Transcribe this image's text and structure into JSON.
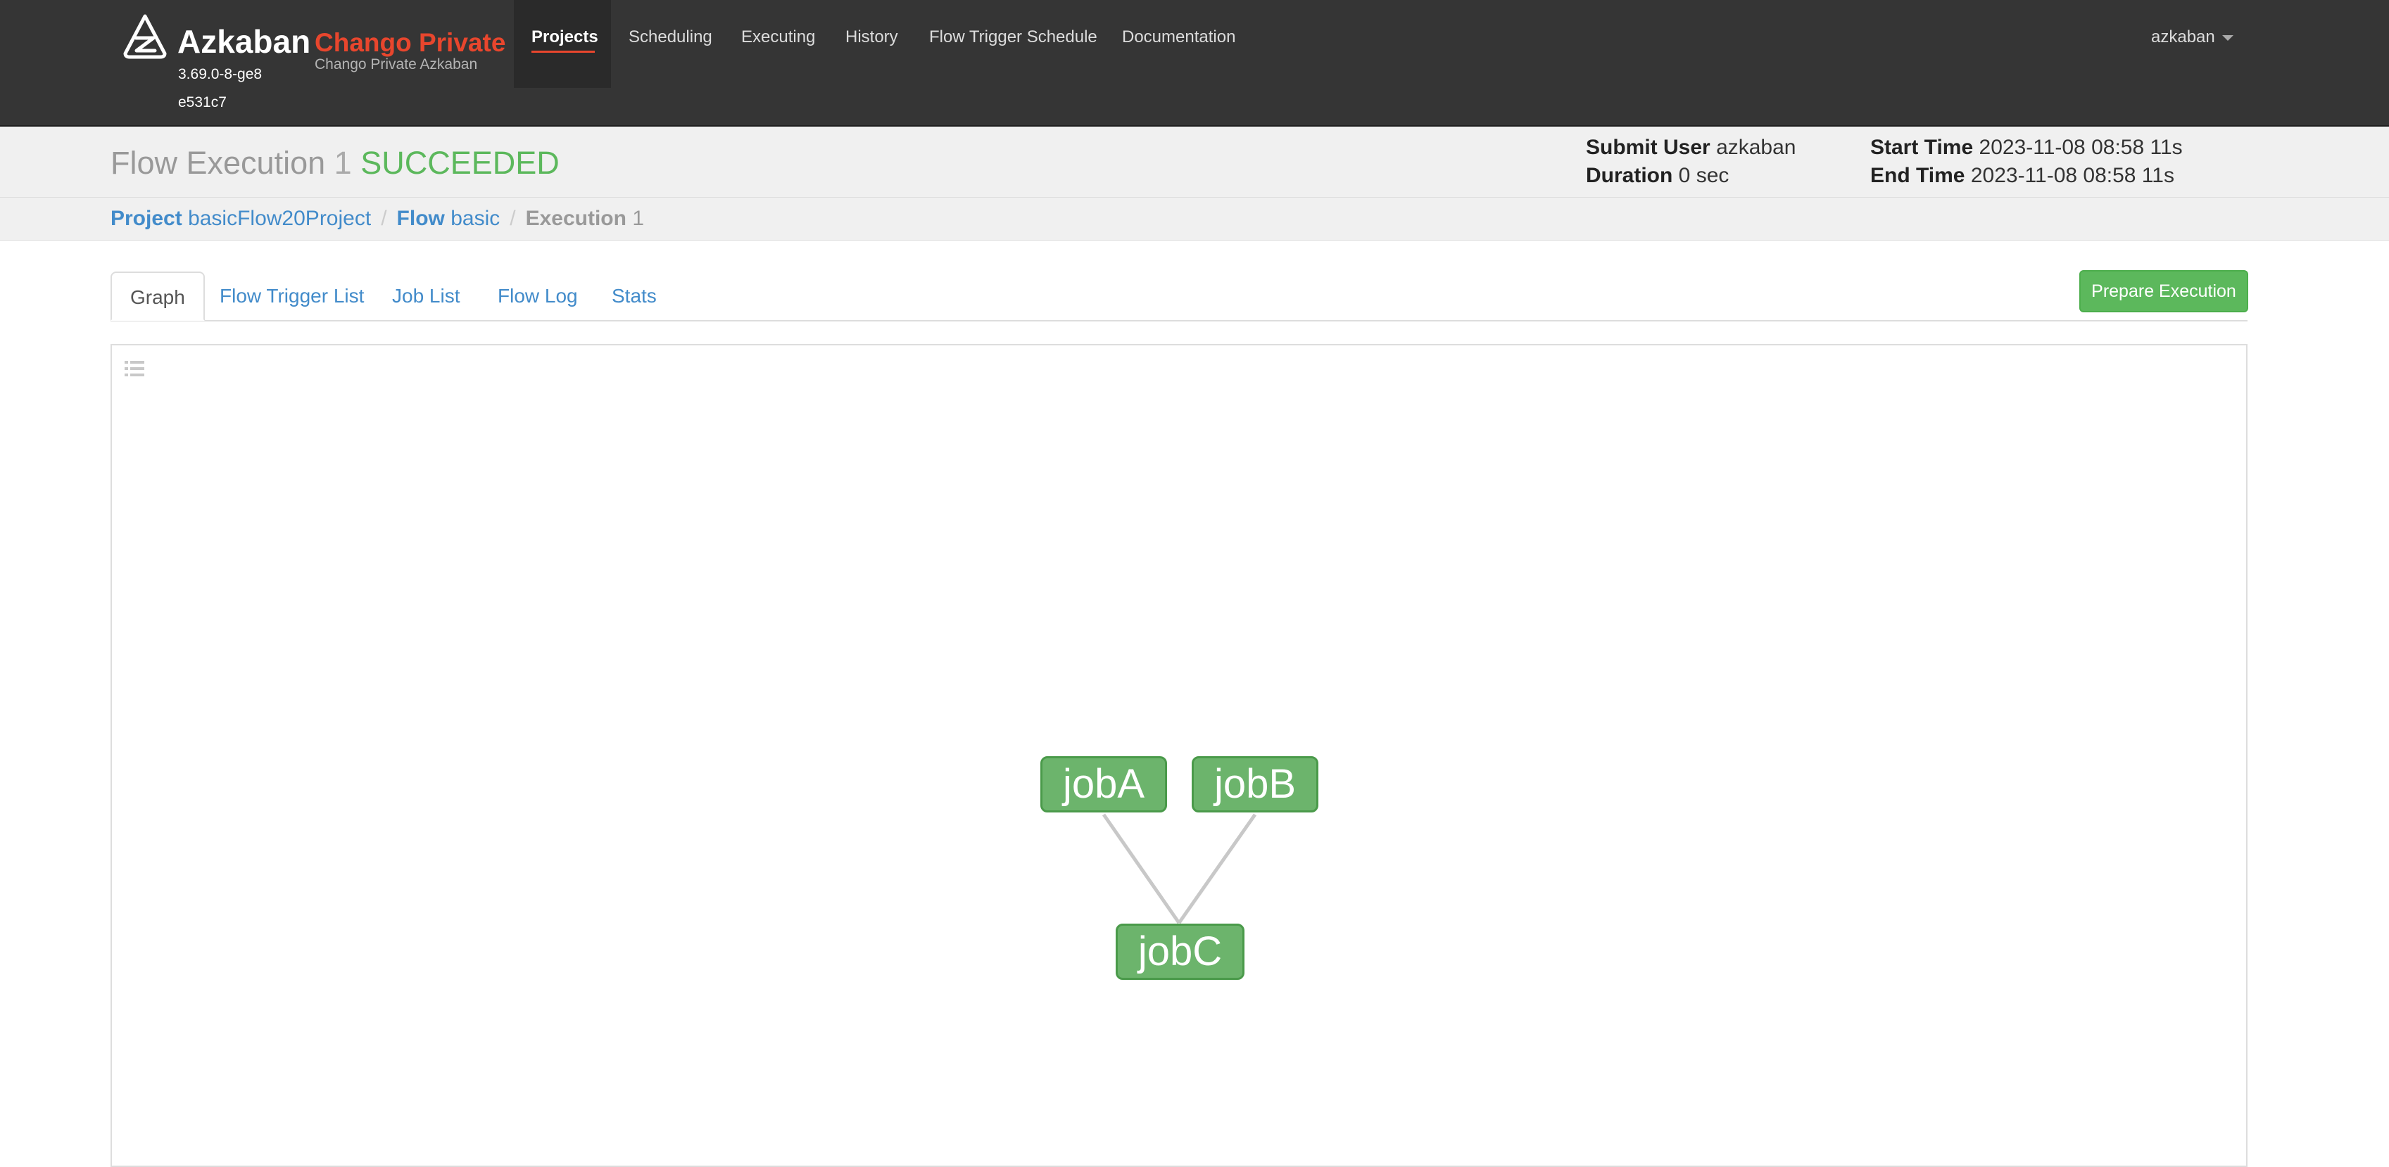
{
  "navbar": {
    "brand": "Azkaban",
    "brand_sub": "Chango Private",
    "tagline": "Chango Private Azkaban",
    "version": "3.69.0-8-ge8e531c7",
    "links": [
      "Projects",
      "Scheduling",
      "Executing",
      "History",
      "Flow Trigger Schedule",
      "Documentation"
    ],
    "active_link": "Projects",
    "user": "azkaban"
  },
  "header": {
    "title": "Flow Execution",
    "exec_id": "1",
    "status": "SUCCEEDED",
    "submit_user_label": "Submit User",
    "submit_user": "azkaban",
    "duration_label": "Duration",
    "duration": "0 sec",
    "start_time_label": "Start Time",
    "start_time": "2023-11-08 08:58 11s",
    "end_time_label": "End Time",
    "end_time": "2023-11-08 08:58 11s"
  },
  "breadcrumb": {
    "project_label": "Project",
    "project": "basicFlow20Project",
    "flow_label": "Flow",
    "flow": "basic",
    "execution_label": "Execution",
    "execution": "1"
  },
  "tabs": [
    "Graph",
    "Flow Trigger List",
    "Job List",
    "Flow Log",
    "Stats"
  ],
  "active_tab": "Graph",
  "prepare_button": "Prepare Execution",
  "graph": {
    "nodes": [
      {
        "id": "jobA",
        "label": "jobA",
        "status": "SUCCEEDED"
      },
      {
        "id": "jobB",
        "label": "jobB",
        "status": "SUCCEEDED"
      },
      {
        "id": "jobC",
        "label": "jobC",
        "status": "SUCCEEDED"
      }
    ],
    "edges": [
      {
        "from": "jobA",
        "to": "jobC"
      },
      {
        "from": "jobB",
        "to": "jobC"
      }
    ]
  },
  "colors": {
    "navbar_bg": "#353535",
    "brand_accent": "#e8462d",
    "status_green": "#5cb85c",
    "node_fill": "#6cb46c",
    "link_blue": "#428bca"
  },
  "icons": {
    "logo": "azkaban-logo-icon",
    "panel_toggle": "list-icon",
    "user_caret": "caret-down-icon"
  }
}
